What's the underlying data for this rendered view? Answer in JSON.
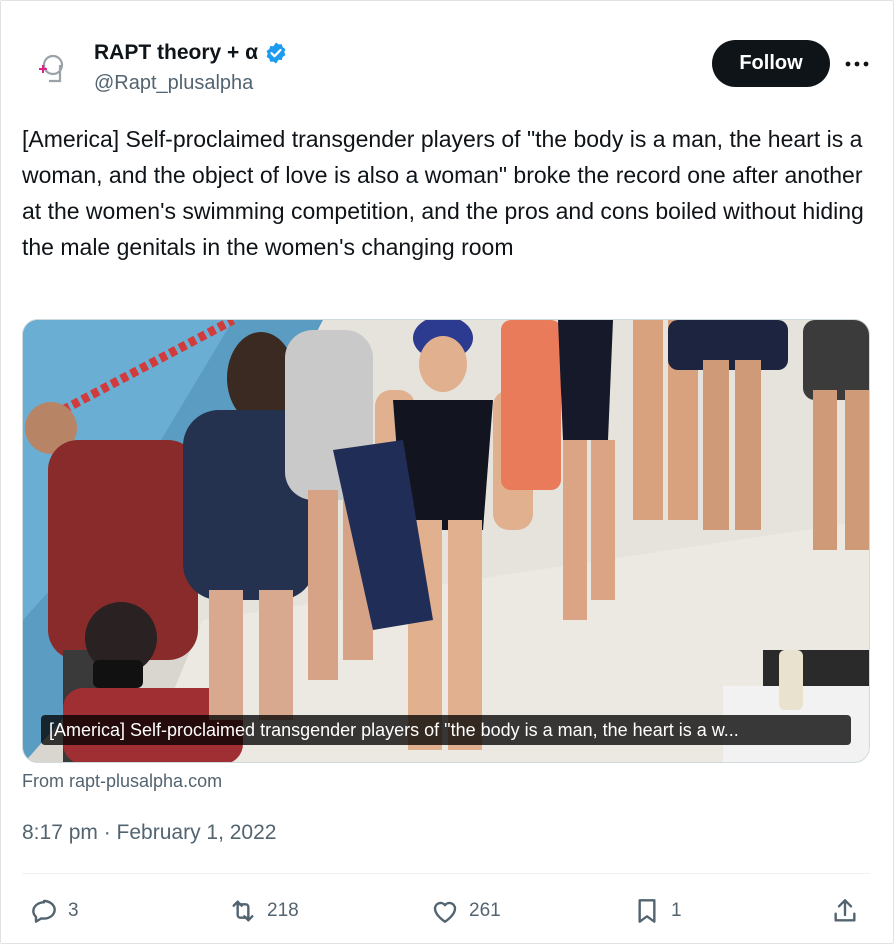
{
  "author": {
    "display_name": "RAPT theory + α",
    "handle": "@Rapt_plusalpha",
    "verified": true,
    "avatar_icon": "logo-icon"
  },
  "header": {
    "follow_label": "Follow",
    "more_icon": "more-icon"
  },
  "tweet": {
    "text": "[America] Self-proclaimed transgender players of \"the body is a man, the heart is a woman, and the object of love is also a woman\" broke the record one after another at the women's swimming competition, and the pros and cons boiled without hiding the male genitals in the women's changing room",
    "media_caption": "[America] Self-proclaimed transgender players of \"the body is a man, the heart is a w...",
    "source": "From rapt-plusalpha.com",
    "timestamp": "8:17 pm · February 1, 2022"
  },
  "actions": {
    "reply_count": "3",
    "retweet_count": "218",
    "like_count": "261",
    "bookmark_count": "1"
  },
  "colors": {
    "accent": "#1d9bf0",
    "text": "#0f1419",
    "secondary": "#536471"
  }
}
